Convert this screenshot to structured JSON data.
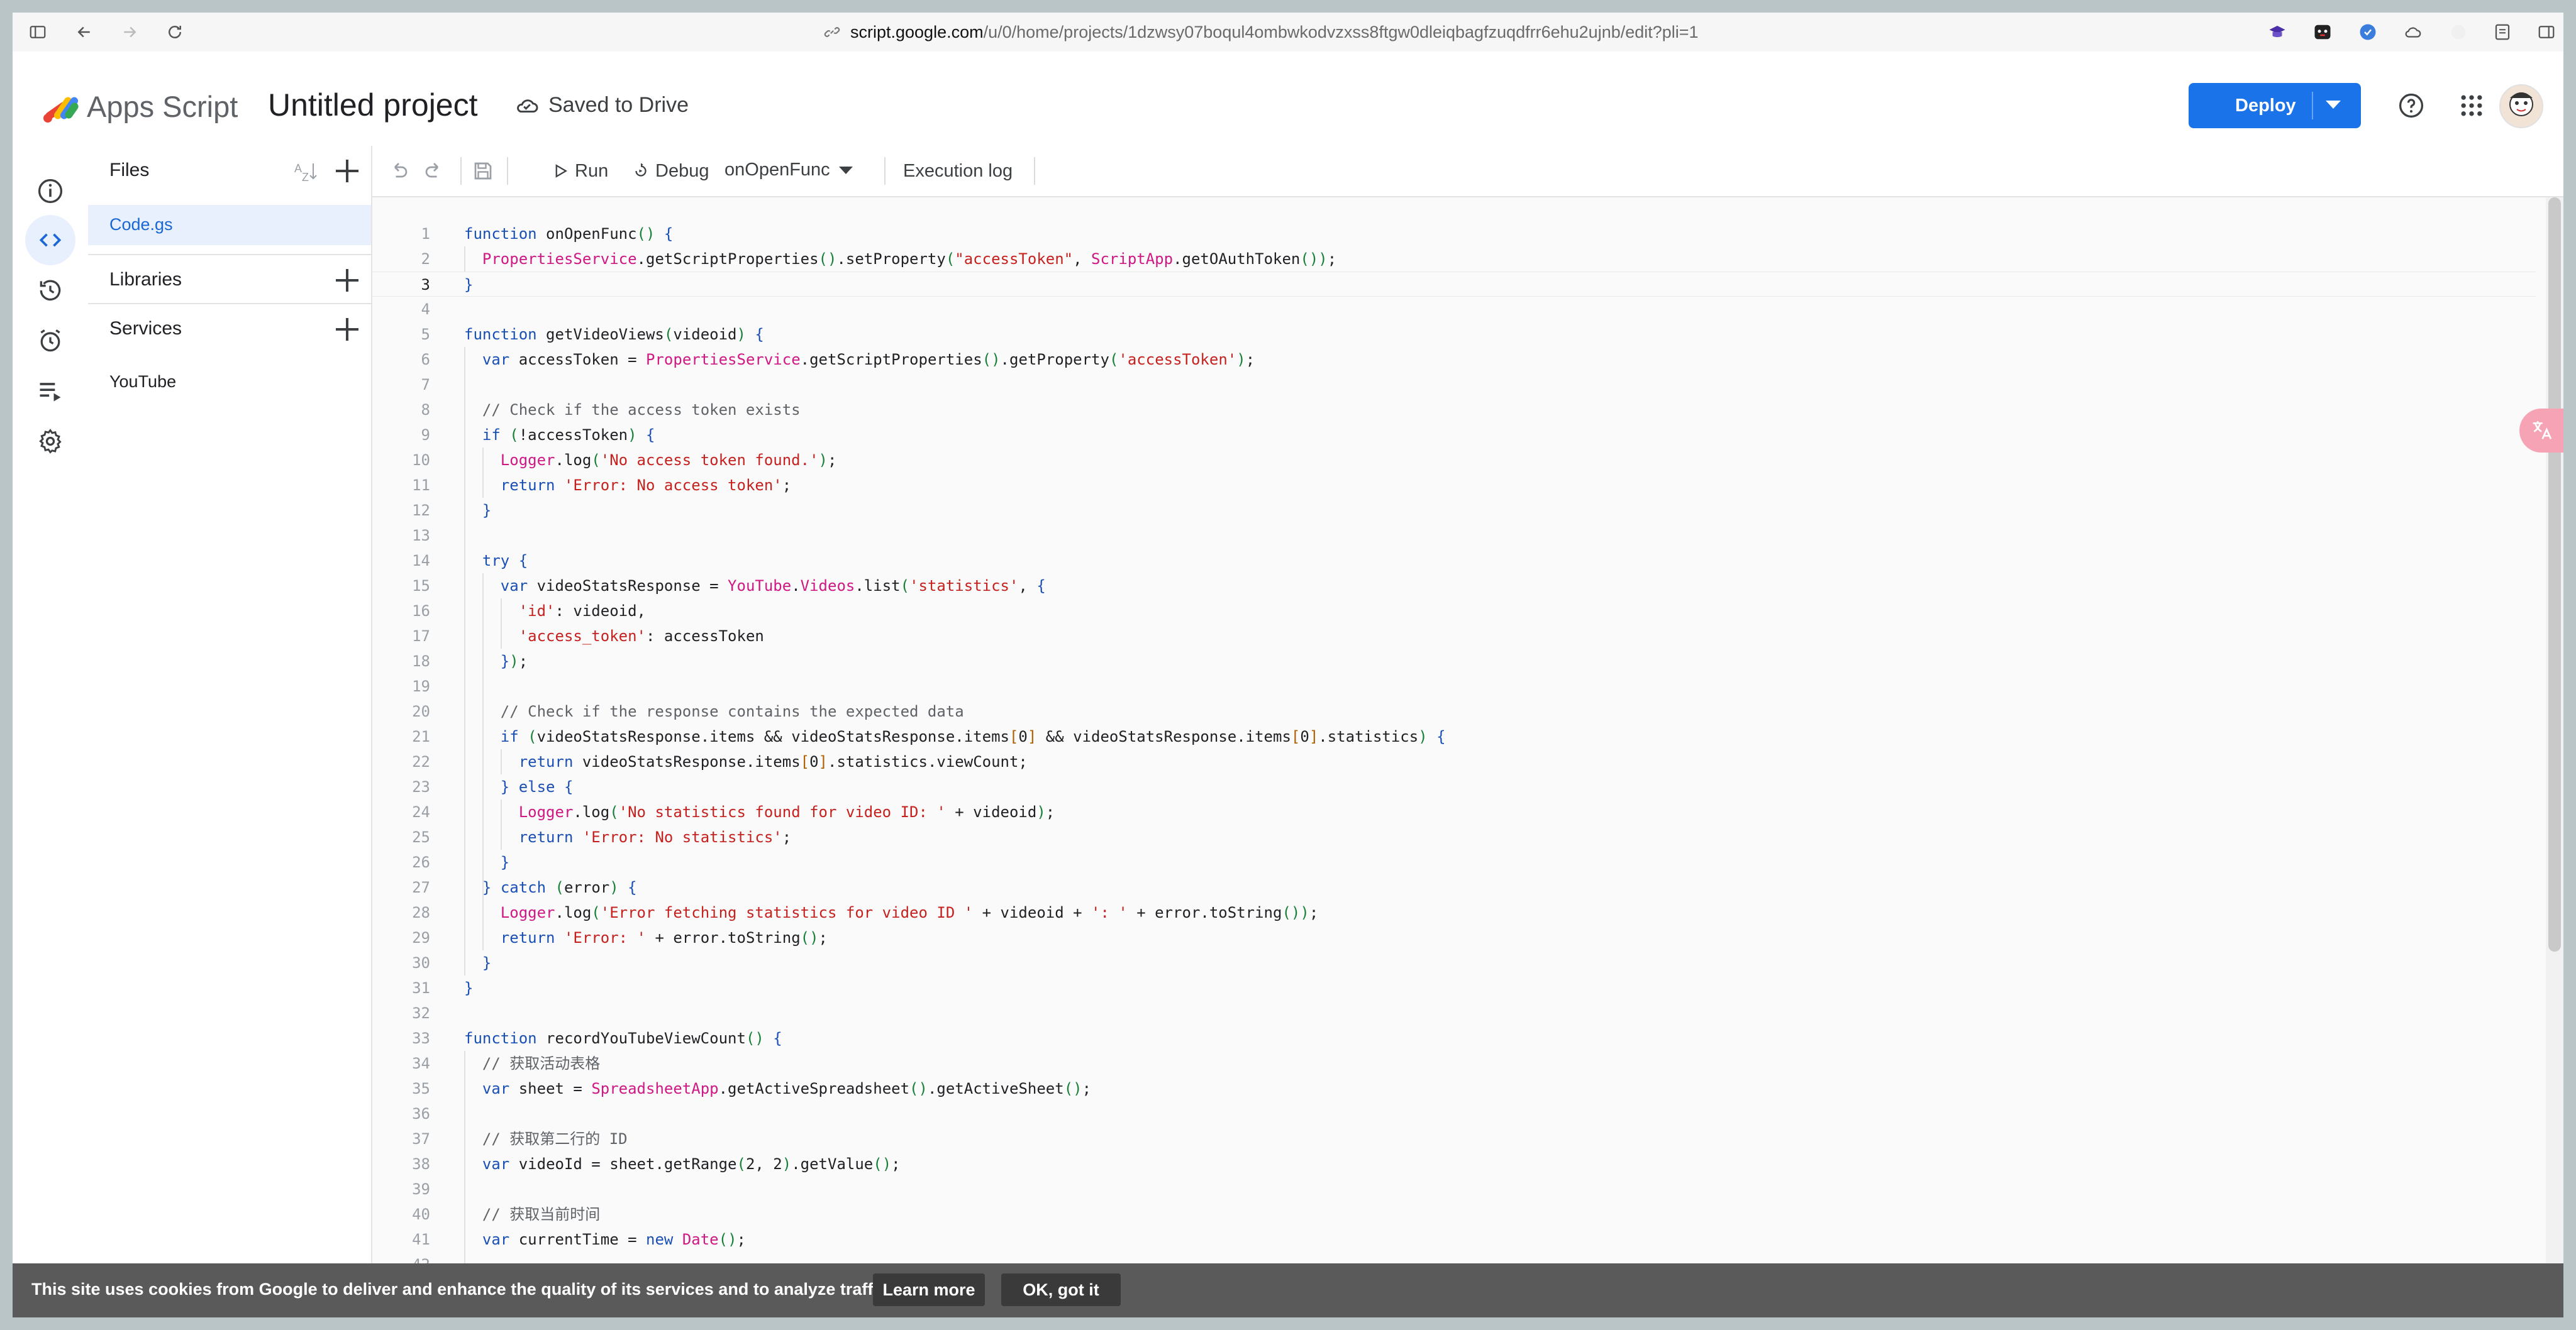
{
  "browser": {
    "url_host": "script.google.com",
    "url_path": "/u/0/home/projects/1dzwsy07boqul4ombwkodvzxss8ftgw0dleiqbagfzuqdfrr6ehu2ujnb/edit?pli=1"
  },
  "header": {
    "app_name": "Apps Script",
    "project_title": "Untitled project",
    "saved_status": "Saved to Drive",
    "deploy_label": "Deploy"
  },
  "files_panel": {
    "title": "Files",
    "files": [
      "Code.gs"
    ],
    "libraries_label": "Libraries",
    "services_label": "Services",
    "services": [
      "YouTube"
    ]
  },
  "toolbar": {
    "run_label": "Run",
    "debug_label": "Debug",
    "function_selected": "onOpenFunc",
    "execution_log_label": "Execution log"
  },
  "code": {
    "current_line": 3,
    "lines": [
      "function onOpenFunc() {",
      "  PropertiesService.getScriptProperties().setProperty(\"accessToken\", ScriptApp.getOAuthToken());",
      "}",
      "",
      "function getVideoViews(videoid) {",
      "  var accessToken = PropertiesService.getScriptProperties().getProperty('accessToken');",
      "",
      "  // Check if the access token exists",
      "  if (!accessToken) {",
      "    Logger.log('No access token found.');",
      "    return 'Error: No access token';",
      "  }",
      "",
      "  try {",
      "    var videoStatsResponse = YouTube.Videos.list('statistics', {",
      "      'id': videoid,",
      "      'access_token': accessToken",
      "    });",
      "",
      "    // Check if the response contains the expected data",
      "    if (videoStatsResponse.items && videoStatsResponse.items[0] && videoStatsResponse.items[0].statistics) {",
      "      return videoStatsResponse.items[0].statistics.viewCount;",
      "    } else {",
      "      Logger.log('No statistics found for video ID: ' + videoid);",
      "      return 'Error: No statistics';",
      "    }",
      "  } catch (error) {",
      "    Logger.log('Error fetching statistics for video ID ' + videoid + ': ' + error.toString());",
      "    return 'Error: ' + error.toString();",
      "  }",
      "}",
      "",
      "function recordYouTubeViewCount() {",
      "  // 获取活动表格",
      "  var sheet = SpreadsheetApp.getActiveSpreadsheet().getActiveSheet();",
      "",
      "  // 获取第二行的 ID",
      "  var videoId = sheet.getRange(2, 2).getValue();",
      "",
      "  // 获取当前时间",
      "  var currentTime = new Date();",
      ""
    ]
  },
  "cookie_bar": {
    "text": "This site uses cookies from Google to deliver and enhance the quality of its services and to analyze traffic.",
    "learn_more": "Learn more",
    "ok": "OK, got it"
  },
  "colors": {
    "accent": "#1a73e8",
    "keyword": "#1a50b5",
    "string": "#c5221f",
    "class": "#d01884",
    "comment": "#5f6368"
  }
}
